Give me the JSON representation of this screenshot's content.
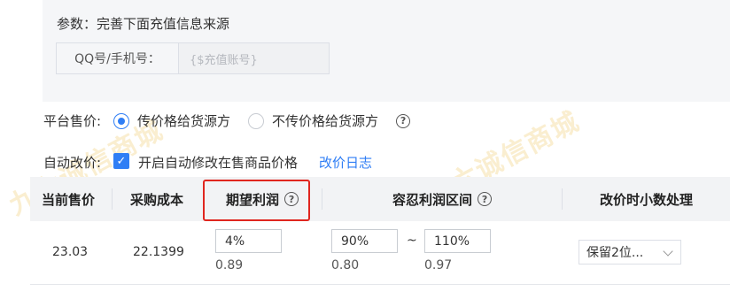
{
  "params": {
    "title": "参数：完善下面充值信息来源",
    "field_label": "QQ号/手机号：",
    "field_value": "{$充值账号}"
  },
  "platform_price": {
    "label": "平台售价:",
    "options": [
      "传价格给货源方",
      "不传价格给货源方"
    ],
    "selected": 0
  },
  "auto_adjust": {
    "label": "自动改价:",
    "checkbox_label": "开启自动修改在售商品价格",
    "checked": true,
    "log_link": "改价日志"
  },
  "table": {
    "headers": {
      "current_price": "当前售价",
      "cost": "采购成本",
      "expected_profit": "期望利润",
      "profit_range": "容忍利润区间",
      "decimal_handling": "改价时小数处理"
    },
    "row": {
      "current_price": "23.03",
      "cost": "22.1399",
      "expected_profit_input": "4%",
      "expected_profit_value": "0.89",
      "range_min_input": "90%",
      "range_min_value": "0.80",
      "range_separator": "~",
      "range_max_input": "110%",
      "range_max_value": "0.97",
      "decimal_option": "保留2位..."
    }
  },
  "watermark": "九六诚信商城",
  "colors": {
    "accent": "#2f7ef5",
    "highlight_border": "#e0261f",
    "header_bg": "#f2f3f5",
    "panel_bg": "#f5f6f8"
  },
  "icons": [
    "help-icon",
    "check-icon",
    "chevron-down-icon"
  ]
}
